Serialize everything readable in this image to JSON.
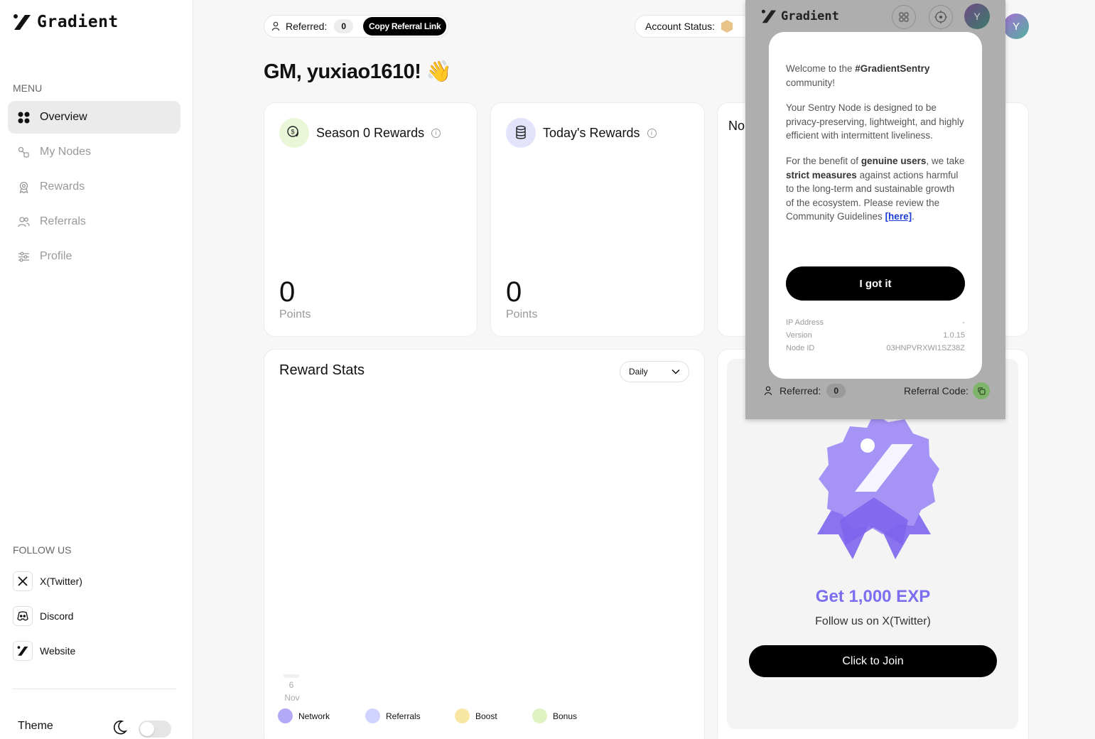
{
  "sidebar": {
    "logo_text": "Gradient",
    "menu_caption": "MENU",
    "nav": [
      {
        "label": "Overview",
        "icon": "grid-icon",
        "active": true
      },
      {
        "label": "My Nodes",
        "icon": "nodes-icon",
        "active": false
      },
      {
        "label": "Rewards",
        "icon": "award-icon",
        "active": false
      },
      {
        "label": "Referrals",
        "icon": "users-icon",
        "active": false
      },
      {
        "label": "Profile",
        "icon": "sliders-icon",
        "active": false
      }
    ],
    "follow_caption": "FOLLOW US",
    "socials": [
      {
        "label": "X(Twitter)",
        "icon": "x-twitter-icon"
      },
      {
        "label": "Discord",
        "icon": "discord-icon"
      },
      {
        "label": "Website",
        "icon": "gradient-logo-icon"
      }
    ],
    "theme_label": "Theme"
  },
  "topbar": {
    "referred_label": "Referred:",
    "referred_count": "0",
    "copy_link_label": "Copy Referral Link",
    "account_status_label": "Account Status:",
    "avatar_letter": "Y"
  },
  "greeting": "GM, yuxiao1610! 👋",
  "season_card": {
    "title": "Season 0 Rewards",
    "value": "0",
    "unit": "Points"
  },
  "today_card": {
    "title": "Today's Rewards",
    "value": "0",
    "unit": "Points"
  },
  "nodes_card": {
    "title_partial": "No"
  },
  "reward_stats": {
    "title": "Reward Stats",
    "period": "Daily",
    "x_tick_day": "6",
    "x_tick_month": "Nov",
    "legend": [
      {
        "label": "Network",
        "color": "#b3a9f7"
      },
      {
        "label": "Referrals",
        "color": "#cfd3ff"
      },
      {
        "label": "Boost",
        "color": "#f7e7a3"
      },
      {
        "label": "Bonus",
        "color": "#dff2c2"
      }
    ]
  },
  "promo": {
    "title": "Get 1,000 EXP",
    "subtitle": "Follow us on X(Twitter)",
    "button": "Click to Join"
  },
  "extension": {
    "logo_text": "Gradient",
    "avatar_letter": "Y",
    "welcome_pre": "Welcome to the ",
    "welcome_bold": "#GradientSentry",
    "welcome_post": " community!",
    "para2": "Your Sentry Node is designed to be privacy-preserving, lightweight, and highly efficient with intermittent liveliness.",
    "para3_a": "For the benefit of ",
    "para3_b": "genuine users",
    "para3_c": ", we take ",
    "para3_d": "strict measures",
    "para3_e": " against actions harmful to the long-term and sustainable growth of the ecosystem. Please review the Community Guidelines ",
    "para3_link": "[here]",
    "para3_end": ".",
    "button": "I got it",
    "meta": [
      {
        "label": "IP Address",
        "value": "-"
      },
      {
        "label": "Version",
        "value": "1.0.15"
      },
      {
        "label": "Node ID",
        "value": "03HNPVRXWI1SZ38Z"
      }
    ],
    "referred_label": "Referred:",
    "referred_count": "0",
    "referral_code_label": "Referral Code:"
  }
}
